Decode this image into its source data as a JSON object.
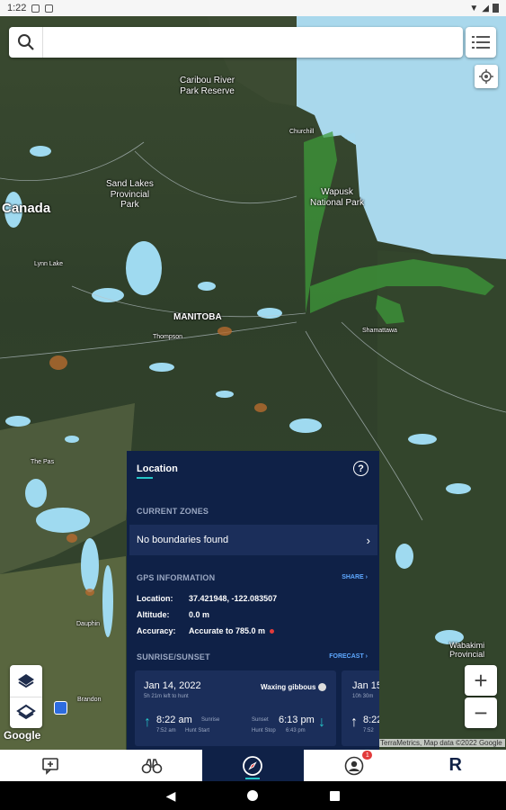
{
  "status_bar": {
    "time": "1:22"
  },
  "search": {
    "placeholder": ""
  },
  "map": {
    "labels": {
      "caribou": "Caribou River\nPark Reserve",
      "sand_lakes": "Sand Lakes\nProvincial\nPark",
      "canada": "Canada",
      "wapusk": "Wapusk\nNational Park",
      "manitoba": "MANITOBA",
      "thompson": "Thompson",
      "churchill": "Churchill",
      "shamattawa": "Shamattawa",
      "lynn_lake": "Lynn Lake",
      "brandon": "Brandon",
      "dauphin": "Dauphin",
      "the_pas": "The Pas",
      "wabakimi": "Wabakimi\nProvincial"
    },
    "google_logo": "Google",
    "attribution": "TerraMetrics, Map data ©2022 Google"
  },
  "zoom": {
    "in": "+",
    "out": "−"
  },
  "panel": {
    "title": "Location",
    "help": "?",
    "current_zones_label": "CURRENT ZONES",
    "zones_value": "No boundaries found",
    "gps_label": "GPS INFORMATION",
    "share_label": "SHARE",
    "location_key": "Location:",
    "location_value": "37.421948, -122.083507",
    "altitude_key": "Altitude:",
    "altitude_value": "0.0 m",
    "accuracy_key": "Accuracy:",
    "accuracy_value": "Accurate to 785.0 m",
    "sunrise_label": "SUNRISE/SUNSET",
    "forecast_label": "FORECAST",
    "cards": [
      {
        "date": "Jan 14, 2022",
        "sub": "5h 21m left to hunt",
        "moon": "Waxing gibbous",
        "sunrise": "8:22 am",
        "sunrise_label": "Sunrise",
        "hunt_start": "7:52 am",
        "hunt_start_label": "Hunt Start",
        "sunset": "6:13 pm",
        "sunset_label": "Sunset",
        "hunt_stop": "6:43 pm",
        "hunt_stop_label": "Hunt Stop"
      },
      {
        "date": "Jan 15",
        "sub": "10h 30m",
        "sunrise": "8:22",
        "hunt_start": "7:52"
      }
    ]
  },
  "bottom_nav": {
    "badge": "1",
    "brand": "R"
  }
}
